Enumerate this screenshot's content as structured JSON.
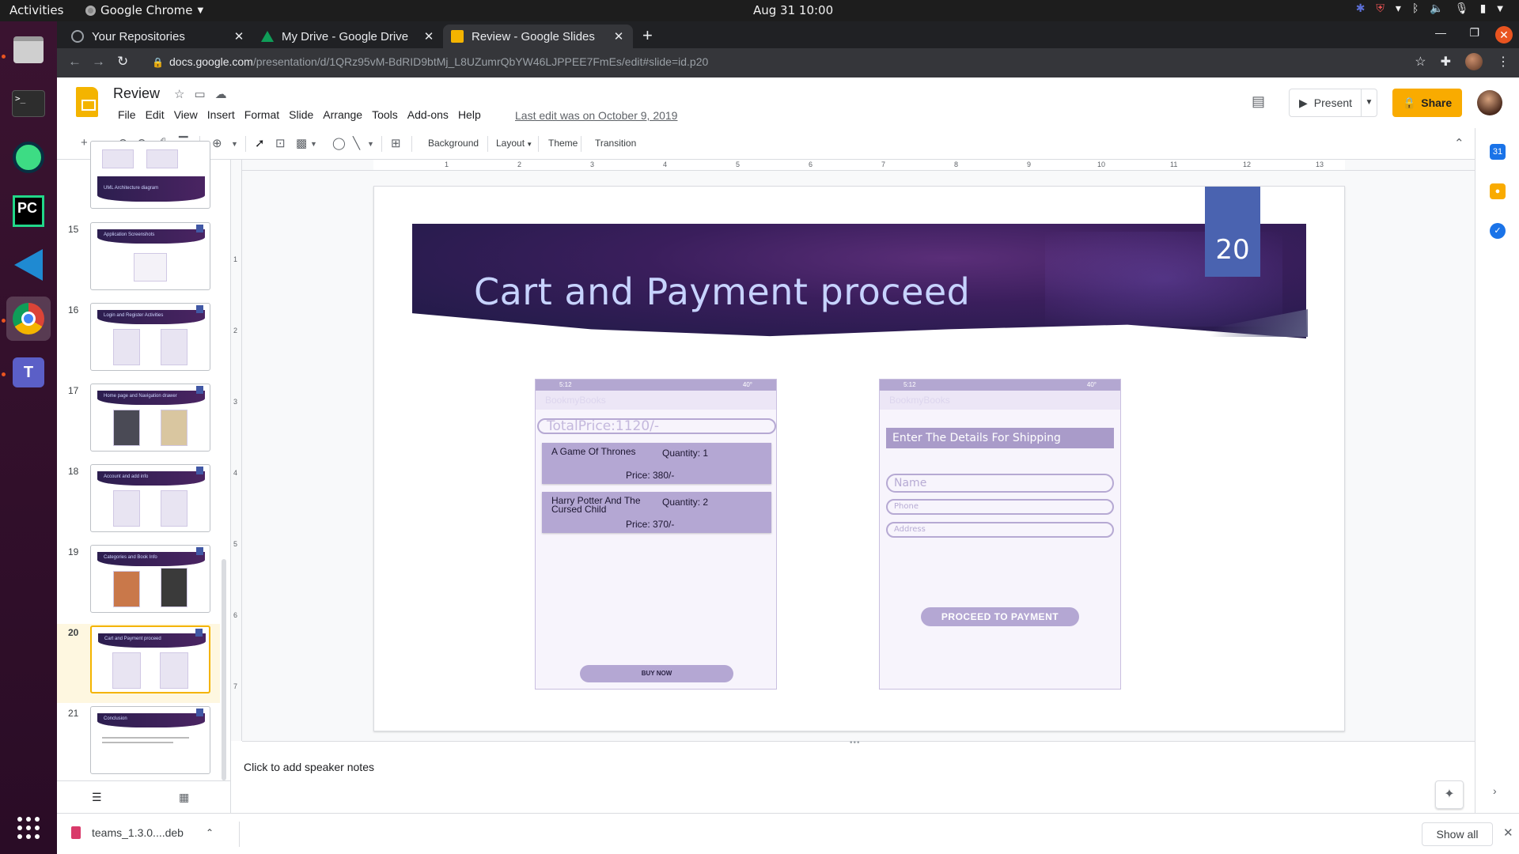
{
  "os": {
    "activities": "Activities",
    "app_name": "Google Chrome",
    "clock": "Aug 31  10:00"
  },
  "browser": {
    "tabs": [
      {
        "title": "Your Repositories"
      },
      {
        "title": "My Drive - Google Drive"
      },
      {
        "title": "Review - Google Slides"
      }
    ],
    "url_host": "docs.google.com",
    "url_path": "/presentation/d/1QRz95vM-BdRID9btMj_L8UZumrQbYW46LJPPEE7FmEs/edit#slide=id.p20"
  },
  "doc": {
    "title": "Review",
    "menus": [
      "File",
      "Edit",
      "View",
      "Insert",
      "Format",
      "Slide",
      "Arrange",
      "Tools",
      "Add-ons",
      "Help"
    ],
    "last_edit": "Last edit was on October 9, 2019",
    "present_label": "Present",
    "share_label": "Share"
  },
  "toolbar": {
    "background": "Background",
    "layout": "Layout",
    "theme": "Theme",
    "transition": "Transition"
  },
  "ruler": {
    "h_labels": [
      "1",
      "2",
      "3",
      "4",
      "5",
      "6",
      "7",
      "8",
      "9",
      "10",
      "11",
      "12",
      "13"
    ],
    "v_labels": [
      "1",
      "2",
      "3",
      "4",
      "5",
      "6",
      "7"
    ]
  },
  "filmstrip": {
    "slides": [
      {
        "num": "",
        "title": "UML Architecture diagram"
      },
      {
        "num": "15",
        "title": "Application Screenshots"
      },
      {
        "num": "16",
        "title": "Login and Register Activities"
      },
      {
        "num": "17",
        "title": "Home page and Navigation drawer"
      },
      {
        "num": "18",
        "title": "Account and add info"
      },
      {
        "num": "19",
        "title": "Categories and Book Info"
      },
      {
        "num": "20",
        "title": "Cart and Payment proceed"
      },
      {
        "num": "21",
        "title": "Conclusion"
      }
    ],
    "selected": "20"
  },
  "slide": {
    "title": "Cart and Payment proceed",
    "number": "20",
    "cart_phone": {
      "status_time": "5:12",
      "status_right": "40°",
      "appbar": "BookmyBooks",
      "total": "TotalPrice:1120/-",
      "items": [
        {
          "name": "A Game Of Thrones",
          "quantity": "Quantity: 1",
          "price": "Price: 380/-"
        },
        {
          "name": "Harry Potter And The Cursed Child",
          "quantity": "Quantity: 2",
          "price": "Price: 370/-"
        }
      ],
      "buy_now": "BUY NOW"
    },
    "shipping_phone": {
      "status_time": "5:12",
      "status_right": "40°",
      "appbar": "BookmyBooks",
      "heading": "Enter The Details For Shipping",
      "fields": [
        "Name",
        "Phone",
        "Address"
      ],
      "proceed": "PROCEED TO PAYMENT"
    }
  },
  "notes": {
    "placeholder": "Click to add speaker notes"
  },
  "downloads": {
    "file": "teams_1.3.0....deb",
    "show_all": "Show all"
  },
  "colors": {
    "accent_yellow": "#f9ab00",
    "slide_purple": "#3a1e5c",
    "number_box": "#4a63b0"
  }
}
